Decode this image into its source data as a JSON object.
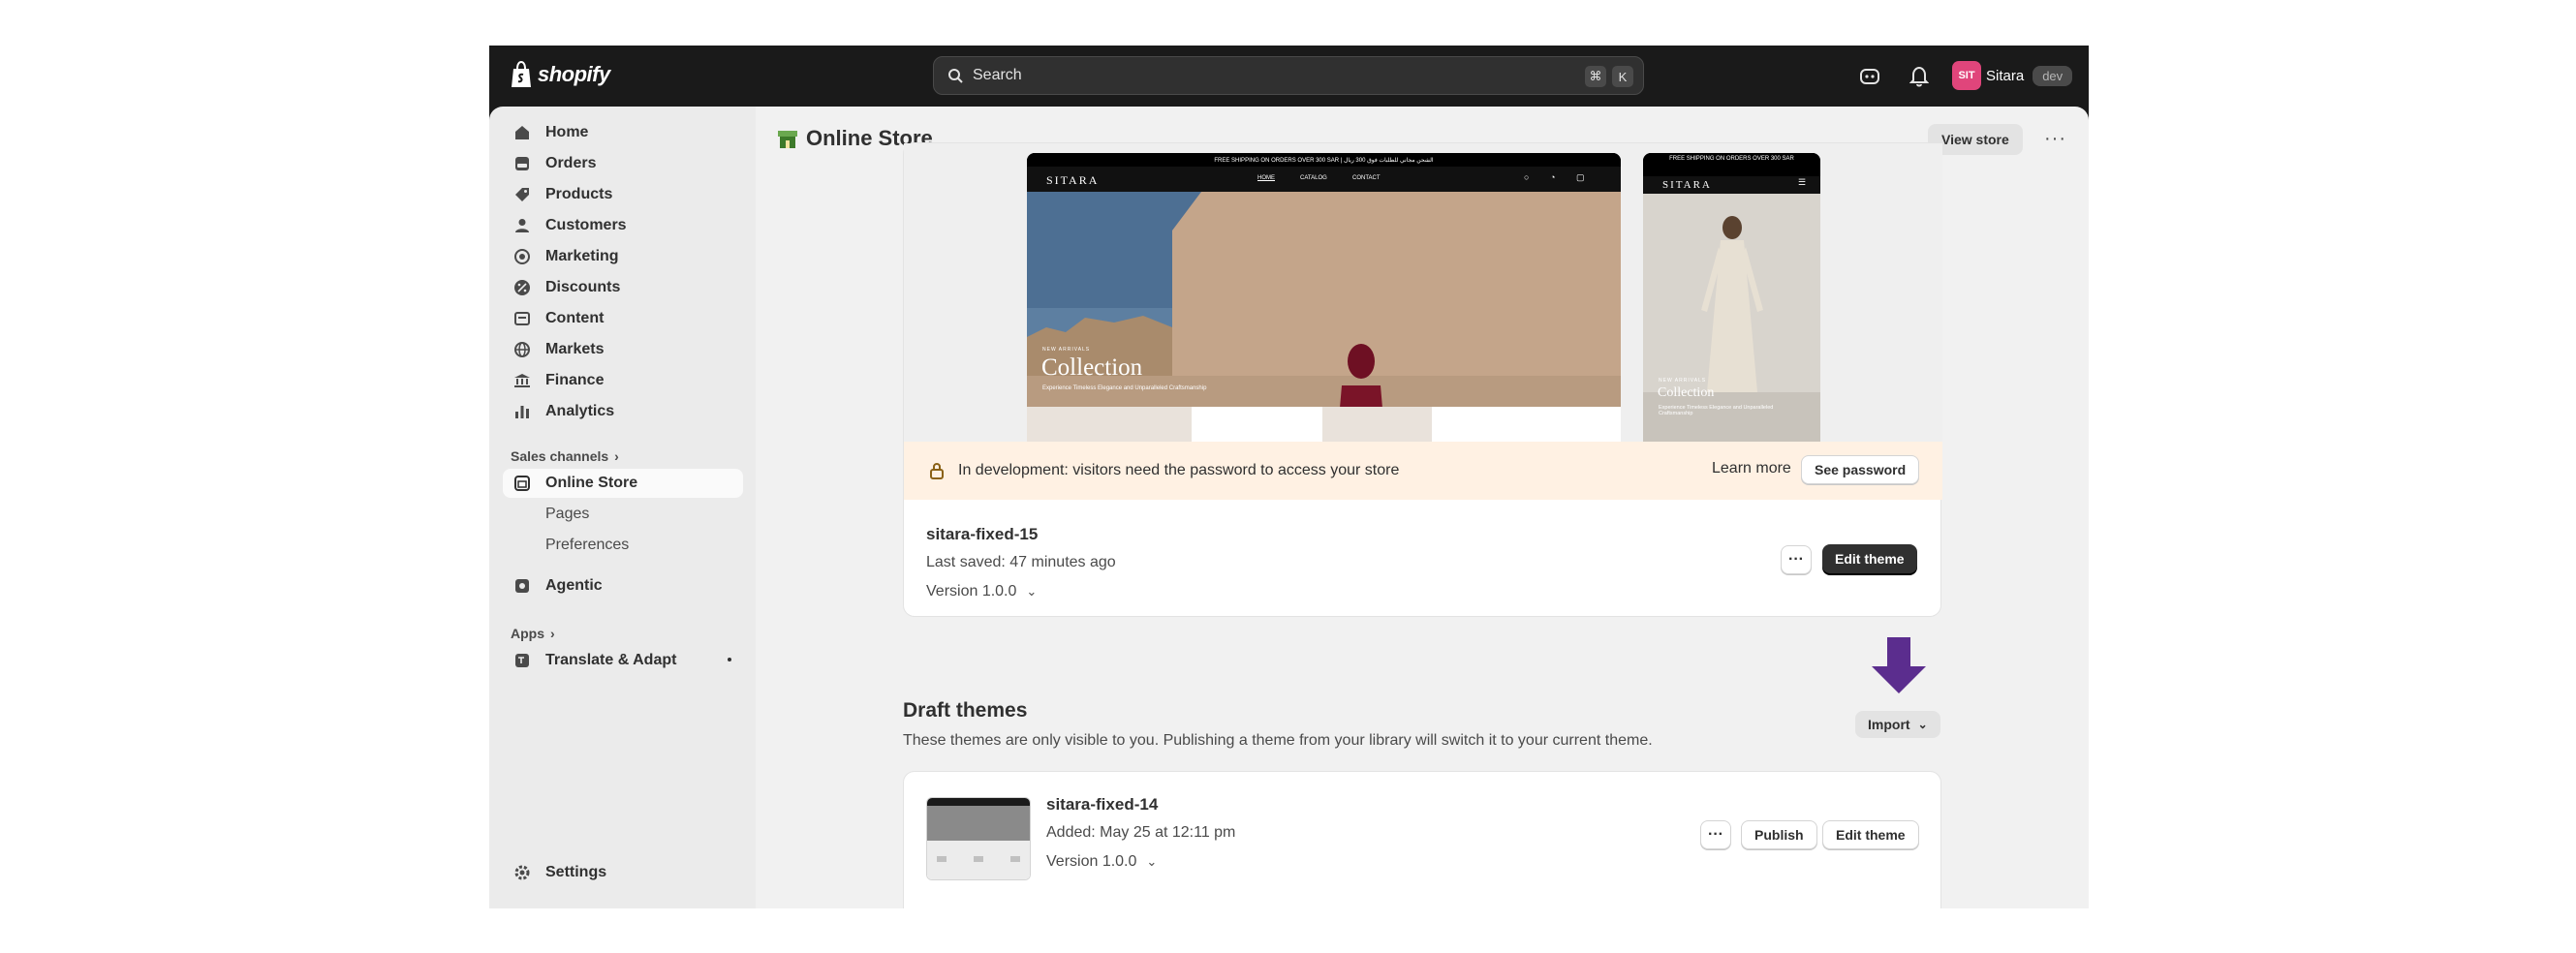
{
  "brand": {
    "name": "shopify"
  },
  "search": {
    "placeholder": "Search",
    "key1": "⌘",
    "key2": "K"
  },
  "user": {
    "initials": "SIT",
    "name": "Sitara",
    "badge": "dev"
  },
  "nav": {
    "items": [
      {
        "label": "Home",
        "icon": "home-icon"
      },
      {
        "label": "Orders",
        "icon": "orders-icon"
      },
      {
        "label": "Products",
        "icon": "tag-icon"
      },
      {
        "label": "Customers",
        "icon": "person-icon"
      },
      {
        "label": "Marketing",
        "icon": "target-icon"
      },
      {
        "label": "Discounts",
        "icon": "discount-icon"
      },
      {
        "label": "Content",
        "icon": "content-icon"
      },
      {
        "label": "Markets",
        "icon": "globe-icon"
      },
      {
        "label": "Finance",
        "icon": "bank-icon"
      },
      {
        "label": "Analytics",
        "icon": "bar-chart-icon"
      }
    ],
    "sales_channels_label": "Sales channels",
    "online_store": "Online Store",
    "pages": "Pages",
    "preferences": "Preferences",
    "agentic": "Agentic",
    "apps_label": "Apps",
    "translate": "Translate & Adapt",
    "settings": "Settings"
  },
  "page": {
    "title": "Online Store",
    "view_store": "View store"
  },
  "preview": {
    "banner": "FREE SHIPPING ON ORDERS OVER 300 SAR | الشحن مجاني للطلبات فوق 300 ريال",
    "mobile_banner": "FREE SHIPPING ON ORDERS OVER 300 SAR",
    "store_name": "SITARA",
    "nav_links": [
      "HOME",
      "CATALOG",
      "CONTACT"
    ],
    "hero_eyebrow": "NEW ARRIVALS",
    "hero_title": "Collection",
    "hero_subtitle": "Experience Timeless Elegance and Unparalleled Craftsmanship"
  },
  "alert": {
    "text": "In development: visitors need the password to access your store",
    "learn_more": "Learn more",
    "see_password": "See password"
  },
  "current_theme": {
    "name": "sitara-fixed-15",
    "saved": "Last saved: 47 minutes ago",
    "version": "Version 1.0.0",
    "edit": "Edit theme"
  },
  "drafts": {
    "title": "Draft themes",
    "description": "These themes are only visible to you. Publishing a theme from your library will switch it to your current theme.",
    "import": "Import",
    "items": [
      {
        "name": "sitara-fixed-14",
        "added": "Added: May 25 at 12:11 pm",
        "version": "Version 1.0.0",
        "publish": "Publish",
        "edit": "Edit theme"
      }
    ]
  },
  "colors": {
    "annotation_arrow": "#5b2d8e",
    "alert_bg": "#fff1e3"
  }
}
